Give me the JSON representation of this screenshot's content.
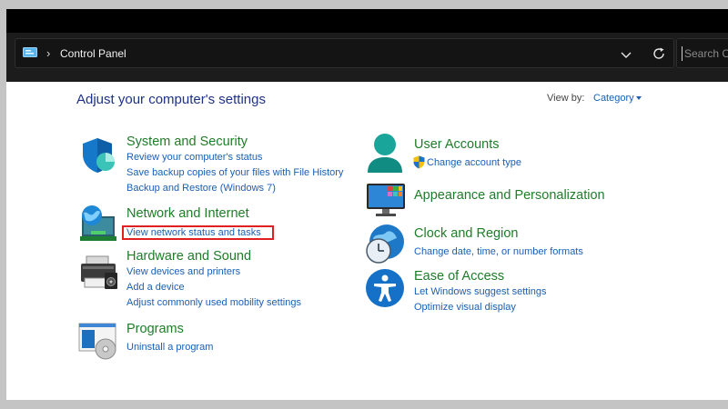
{
  "address": {
    "breadcrumb": "Control Panel",
    "search_placeholder": "Search Co"
  },
  "header": {
    "title": "Adjust your computer's settings",
    "view_by_label": "View by:",
    "view_by_value": "Category"
  },
  "categories": {
    "system": {
      "title": "System and Security",
      "links": [
        "Review your computer's status",
        "Save backup copies of your files with File History",
        "Backup and Restore (Windows 7)"
      ]
    },
    "network": {
      "title": "Network and Internet",
      "links": [
        "View network status and tasks"
      ]
    },
    "hardware": {
      "title": "Hardware and Sound",
      "links": [
        "View devices and printers",
        "Add a device",
        "Adjust commonly used mobility settings"
      ]
    },
    "programs": {
      "title": "Programs",
      "links": [
        "Uninstall a program"
      ]
    },
    "users": {
      "title": "User Accounts",
      "links": [
        "Change account type"
      ]
    },
    "appearance": {
      "title": "Appearance and Personalization",
      "links": []
    },
    "clock": {
      "title": "Clock and Region",
      "links": [
        "Change date, time, or number formats"
      ]
    },
    "access": {
      "title": "Ease of Access",
      "links": [
        "Let Windows suggest settings",
        "Optimize visual display"
      ]
    }
  },
  "colors": {
    "heading": "#1e3287",
    "category_title": "#1e7d28",
    "link": "#1a5fb4",
    "highlight": "#e02020"
  },
  "icons": [
    "control-panel-icon",
    "chevron-right-icon",
    "chevron-down-icon",
    "refresh-icon",
    "shield-icon",
    "globe-network-icon",
    "printer-icon",
    "programs-icon",
    "user-icon",
    "uac-shield-icon",
    "monitor-icon",
    "clock-globe-icon",
    "accessibility-icon"
  ]
}
